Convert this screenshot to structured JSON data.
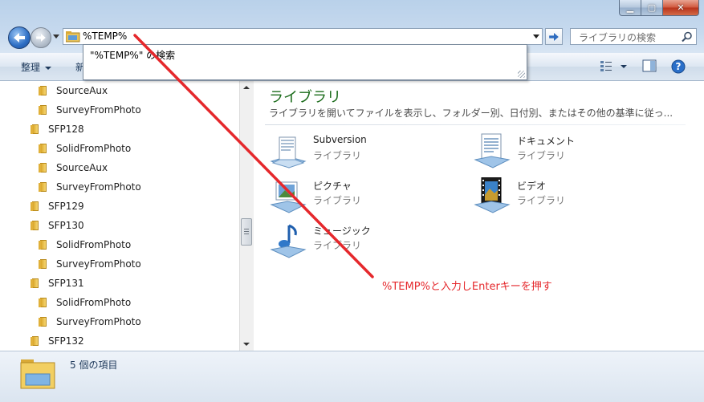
{
  "address": {
    "value": "%TEMP%"
  },
  "search": {
    "placeholder": "ライブラリの検索"
  },
  "toolbar": {
    "organize": "整理",
    "new_partial": "新"
  },
  "suggestion": {
    "text": "\"%TEMP%\" の検索"
  },
  "tree": {
    "items": [
      {
        "label": "SourceAux",
        "level": 2
      },
      {
        "label": "SurveyFromPhoto",
        "level": 2
      },
      {
        "label": "SFP128",
        "level": 1
      },
      {
        "label": "SolidFromPhoto",
        "level": 2
      },
      {
        "label": "SourceAux",
        "level": 2
      },
      {
        "label": "SurveyFromPhoto",
        "level": 2
      },
      {
        "label": "SFP129",
        "level": 1
      },
      {
        "label": "SFP130",
        "level": 1
      },
      {
        "label": "SolidFromPhoto",
        "level": 2
      },
      {
        "label": "SurveyFromPhoto",
        "level": 2
      },
      {
        "label": "SFP131",
        "level": 1
      },
      {
        "label": "SolidFromPhoto",
        "level": 2
      },
      {
        "label": "SurveyFromPhoto",
        "level": 2
      },
      {
        "label": "SFP132",
        "level": 1
      }
    ]
  },
  "library": {
    "title": "ライブラリ",
    "description": "ライブラリを開いてファイルを表示し、フォルダー別、日付別、またはその他の基準に従っ...",
    "items": [
      {
        "name": "Subversion",
        "type": "ライブラリ",
        "icon": "subversion-library-icon"
      },
      {
        "name": "ドキュメント",
        "type": "ライブラリ",
        "icon": "documents-library-icon"
      },
      {
        "name": "ピクチャ",
        "type": "ライブラリ",
        "icon": "pictures-library-icon"
      },
      {
        "name": "ビデオ",
        "type": "ライブラリ",
        "icon": "videos-library-icon"
      },
      {
        "name": "ミュージック",
        "type": "ライブラリ",
        "icon": "music-library-icon"
      }
    ]
  },
  "details": {
    "count_text": "5 個の項目"
  },
  "annotation": {
    "text": "%TEMP%と入力しEnterキーを押す",
    "color": "#e5282c"
  }
}
